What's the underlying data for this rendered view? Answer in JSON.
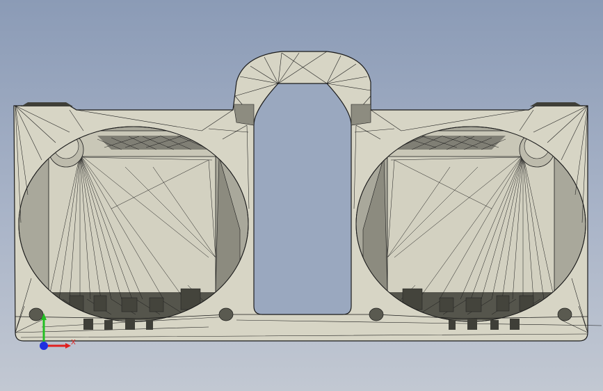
{
  "viewport": {
    "background_top": "#8b9bb6",
    "background_bottom": "#c2c8d2"
  },
  "model": {
    "face_color": "#d6d4c4",
    "shade_color": "#9a998c",
    "dark_color": "#3f3f38",
    "edge_color": "#1a1a1a"
  },
  "triad": {
    "x_label": "X",
    "x_color": "#e02020",
    "y_color": "#22c022",
    "z_color": "#2030e0"
  }
}
